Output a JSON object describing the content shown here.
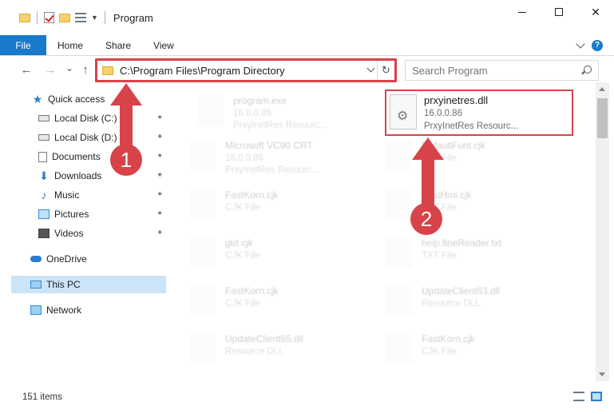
{
  "window": {
    "title": "Program",
    "minimize": "—",
    "maximize": "",
    "close": "✕"
  },
  "ribbon": {
    "file": "File",
    "tabs": [
      "Home",
      "Share",
      "View"
    ],
    "help": "?"
  },
  "nav": {
    "back": "←",
    "forward": "→",
    "recent": "⌄",
    "up": "↑",
    "address": "C:\\Program Files\\Program Directory",
    "refresh": "↻",
    "search_placeholder": "Search Program"
  },
  "sidebar": {
    "items": [
      {
        "label": "Quick access",
        "icon": "star-icon"
      },
      {
        "label": "Local Disk (C:)",
        "icon": "disk-icon",
        "pinned": true
      },
      {
        "label": "Local Disk (D:)",
        "icon": "disk-icon",
        "pinned": true
      },
      {
        "label": "Documents",
        "icon": "documents-icon",
        "pinned": true
      },
      {
        "label": "Downloads",
        "icon": "download-icon",
        "pinned": true
      },
      {
        "label": "Music",
        "icon": "music-icon",
        "pinned": true
      },
      {
        "label": "Pictures",
        "icon": "pictures-icon",
        "pinned": true
      },
      {
        "label": "Videos",
        "icon": "video-icon",
        "pinned": true
      },
      {
        "label": "OneDrive",
        "icon": "cloud-icon"
      },
      {
        "label": "This PC",
        "icon": "computer-icon",
        "selected": true
      },
      {
        "label": "Network",
        "icon": "network-icon"
      }
    ],
    "pin_glyph": "📌"
  },
  "files": [
    {
      "name": "program.exe",
      "line2": "16.0.0.86",
      "line3": "PrxyInetRes Resourc..."
    },
    {
      "name": "prxyinetres.dll",
      "line2": "16.0.0.86",
      "line3": "PrxyInetRes Resourc..."
    },
    {
      "name": "Microsoft VC90 CRT",
      "line2": "16.0.0.86",
      "line3": "PrxyInetRes Resourc..."
    },
    {
      "name": "DefaultFont.cjk",
      "line2": "CJK File",
      "line3": ""
    },
    {
      "name": "FastKorn.cjk",
      "line2": "CJK File",
      "line3": ""
    },
    {
      "name": "FastHmi.cjk",
      "line2": "CJK File",
      "line3": ""
    },
    {
      "name": "gtd.cjk",
      "line2": "CJK File",
      "line3": ""
    },
    {
      "name": "help.fineReader.txt",
      "line2": "TXT File",
      "line3": ""
    },
    {
      "name": "FastKorn.cjk",
      "line2": "CJK File",
      "line3": ""
    },
    {
      "name": "UpdateClient63.dll",
      "line2": "Resource DLL",
      "line3": ""
    },
    {
      "name": "UpdateClient65.dll",
      "line2": "Resource DLL",
      "line3": ""
    },
    {
      "name": "FastKorn.cjk",
      "line2": "CJK File",
      "line3": ""
    }
  ],
  "status": {
    "count": "151 items"
  },
  "annotations": {
    "step1": "1",
    "step2": "2",
    "color": "#d8434a"
  }
}
